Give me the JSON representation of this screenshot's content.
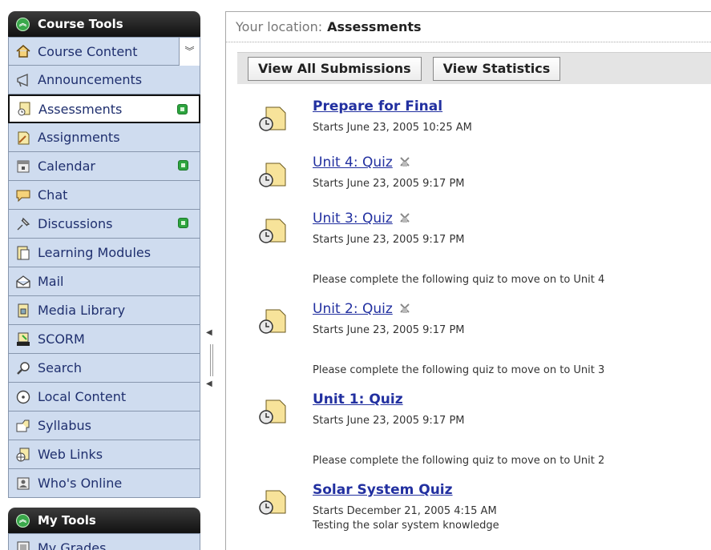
{
  "sidebar": {
    "course_tools_title": "Course Tools",
    "items": [
      {
        "label": "Course Content",
        "icon": "house-icon"
      },
      {
        "label": "Announcements",
        "icon": "megaphone-icon"
      },
      {
        "label": "Assessments",
        "icon": "assessment-icon"
      },
      {
        "label": "Assignments",
        "icon": "assignment-icon"
      },
      {
        "label": "Calendar",
        "icon": "calendar-icon"
      },
      {
        "label": "Chat",
        "icon": "chat-icon"
      },
      {
        "label": "Discussions",
        "icon": "discussion-pin-icon"
      },
      {
        "label": "Learning Modules",
        "icon": "learning-modules-icon"
      },
      {
        "label": "Mail",
        "icon": "mail-icon"
      },
      {
        "label": "Media Library",
        "icon": "media-library-icon"
      },
      {
        "label": "SCORM",
        "icon": "scorm-icon"
      },
      {
        "label": "Search",
        "icon": "search-icon"
      },
      {
        "label": "Local Content",
        "icon": "local-content-icon"
      },
      {
        "label": "Syllabus",
        "icon": "syllabus-icon"
      },
      {
        "label": "Web Links",
        "icon": "web-links-icon"
      },
      {
        "label": "Who's Online",
        "icon": "whos-online-icon"
      }
    ],
    "my_tools_title": "My Tools",
    "my_tools_items": [
      {
        "label": "My Grades"
      }
    ]
  },
  "location": {
    "prefix": "Your location:",
    "current": "Assessments"
  },
  "toolbar": {
    "view_all_submissions": "View All Submissions",
    "view_statistics": "View Statistics"
  },
  "assessments": [
    {
      "title": "Prepare for Final",
      "starts": "Starts June 23, 2005 10:25 AM"
    },
    {
      "title": "Unit 4: Quiz",
      "starts": "Starts June 23, 2005 9:17 PM"
    },
    {
      "title": "Unit 3: Quiz",
      "starts": "Starts June 23, 2005 9:17 PM",
      "note": "Please complete the following quiz to move on to Unit 4"
    },
    {
      "title": "Unit 2: Quiz",
      "starts": "Starts June 23, 2005 9:17 PM",
      "note": "Please complete the following quiz to move on to Unit 3"
    },
    {
      "title": "Unit 1: Quiz",
      "starts": "Starts June 23, 2005 9:17 PM",
      "note": "Please complete the following quiz to move on to Unit 2"
    },
    {
      "title": "Solar System Quiz",
      "starts": "Starts December 21, 2005 4:15 AM",
      "description": "Testing the solar system knowledge"
    }
  ],
  "colors": {
    "sidebar_item_bg": "#cfdcef",
    "link": "#2230a0",
    "badge_green": "#2da43f"
  }
}
